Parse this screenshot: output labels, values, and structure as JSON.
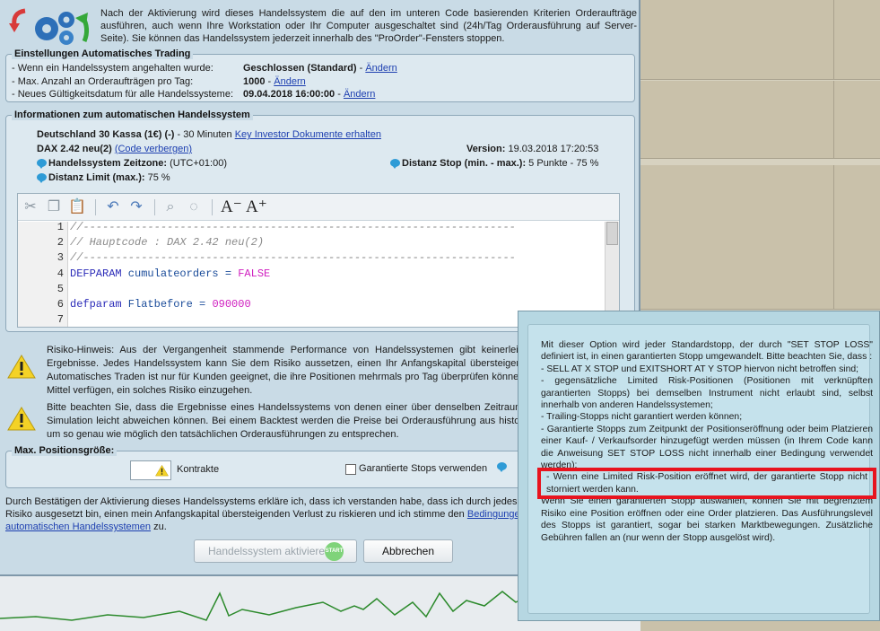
{
  "intro": {
    "text": "Nach der Aktivierung wird dieses Handelssystem die auf den im unteren Code basierenden Kriterien Orderaufträge ausführen, auch wenn Ihre Workstation oder Ihr Computer ausgeschaltet sind (24h/Tag Orderausführung auf Server-Seite). Sie können das Handelssystem jederzeit innerhalb des \"ProOrder\"-Fensters stoppen."
  },
  "settings": {
    "title": "Einstellungen Automatisches Trading",
    "rows": [
      {
        "label": "- Wenn ein Handelssystem angehalten wurde:",
        "value": "Geschlossen (Standard)",
        "sep": " - ",
        "link": "Ändern"
      },
      {
        "label": "- Max. Anzahl an Orderaufträgen pro Tag:",
        "value": "1000",
        "sep": " - ",
        "link": "Ändern"
      },
      {
        "label": "- Neues Gültigkeitsdatum für alle Handelssysteme:",
        "value": "09.04.2018 16:00:00",
        "sep": " - ",
        "link": "Ändern"
      }
    ]
  },
  "info": {
    "title": "Informationen zum automatischen Handelssystem",
    "instrument": "Deutschland 30 Kassa (1€) (-)",
    "timeframe": " - 30 Minuten ",
    "docs_link": "Key Investor Dokumente erhalten",
    "system_name": "DAX 2.42 neu(2)",
    "hide_code_link": "(Code verbergen)",
    "version_label": "Version:",
    "version_value": " 19.03.2018 17:20:53",
    "timezone_label": "Handelssystem Zeitzone:",
    "timezone_value": " (UTC+01:00)",
    "stop_label": "Distanz Stop (min. - max.):",
    "stop_value": " 5 Punkte - 75 %",
    "limit_label": "Distanz Limit (max.):",
    "limit_value": " 75 %"
  },
  "code": {
    "line_numbers": [
      "1",
      "2",
      "3",
      "4",
      "5",
      "6",
      "7"
    ],
    "line1": "//-------------------------------------------------------------------",
    "line2": "// Hauptcode : DAX 2.42 neu(2)",
    "line3": "//-------------------------------------------------------------------",
    "line4_kw": "DEFPARAM",
    "line4_var": " cumulateorders = ",
    "line4_val": "FALSE",
    "line6_kw": "defparam",
    "line6_var": " Flatbefore = ",
    "line6_val": "090000"
  },
  "warnings": {
    "risk": "Risiko-Hinweis: Aus der Vergangenheit stammende Performance von Handelssystemen gibt keinerlei Hinweis auf zukünftige Ergebnisse. Jedes Handelssystem kann Sie dem Risiko aussetzen, einen Ihr Anfangskapital übersteigenden Verlust zu erleiden. Automatisches Traden ist nur für Kunden geeignet, die ihre Positionen mehrmals pro Tag überprüfen können und über die finanzielle Mittel verfügen, ein solches Risiko einzugehen.",
    "backtest": "Bitte beachten Sie, dass die Ergebnisse eines Handelssystems von denen einer über denselben Zeitraum ausgeführten Backtest-Simulation leicht abweichen können. Bei einem Backtest werden die Preise bei Orderausführung aus historischen Daten geschätzt, um so genau wie möglich den tatsächlichen Orderausführungen zu entsprechen."
  },
  "maxpos": {
    "title": "Max. Positionsgröße:",
    "contracts_value": "",
    "contracts_label": "Kontrakte",
    "guaranteed_stops_label": "Garantierte Stops verwenden"
  },
  "confirm": {
    "text": "Durch Bestätigen der Aktivierung dieses Handelssystems erkläre ich, dass ich verstanden habe, dass ich durch jedes Handelssystem dem Risiko ausgesetzt bin, einen mein Anfangskapital übersteigenden Verlust zu riskieren und ich stimme den ",
    "link": "Bedingungen zum Gebrauch von automatischen Handelssystemen",
    "suffix": " zu."
  },
  "buttons": {
    "activate": "Handelssystem aktivieren",
    "start_badge": "START",
    "cancel": "Abbrechen"
  },
  "tooltip": {
    "p1": "Mit dieser Option wird jeder Standardstopp, der durch \"SET STOP LOSS\" definiert ist, in einen garantierten Stopp umgewandelt. Bitte beachten Sie, dass :",
    "p2": "- SELL AT X STOP und EXITSHORT AT Y STOP hiervon nicht betroffen sind;",
    "p3": "- gegensätzliche Limited Risk-Positionen (Positionen mit verknüpften garantierten Stopps) bei demselben Instrument nicht erlaubt sind, selbst innerhalb von anderen Handelssystemen;",
    "p4": "- Trailing-Stopps nicht garantiert werden können;",
    "p5": "- Garantierte Stopps zum Zeitpunkt der Positionseröffnung oder beim Platzieren einer Kauf- / Verkaufsorder hinzugefügt werden müssen (in Ihrem Code kann die Anweisung SET STOP LOSS nicht innerhalb einer Bedingung verwendet werden);",
    "p6": "- Wenn eine Limited Risk-Position eröffnet wird, der garantierte Stopp nicht storniert werden kann.",
    "p7": "Wenn Sie einen garantierten Stopp auswählen, können Sie mit begrenztem Risiko eine Position eröffnen oder eine Order platzieren. Das Ausführungslevel des Stopps ist garantiert, sogar bei starken Marktbewegungen. Zusätzliche Gebühren fallen an (nur wenn der Stopp ausgelöst wird)."
  },
  "colors": {
    "dialog_bg": "#c9dbe6",
    "link": "#1d3fb0",
    "tooltip_bg": "#c5e2ec",
    "highlight": "#e8141f"
  }
}
